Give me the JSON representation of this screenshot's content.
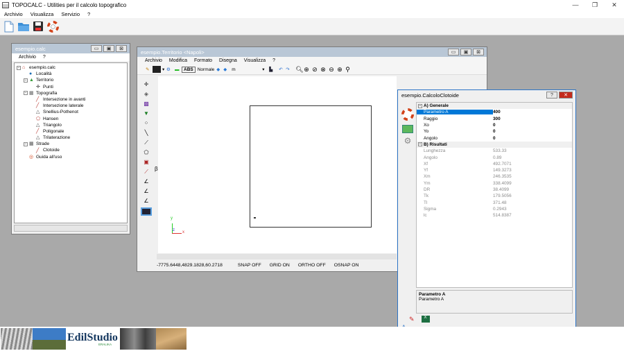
{
  "app": {
    "title": "TOPOCALC - Utilities per il calcolo topografico",
    "menu": [
      "Archivio",
      "Visualizza",
      "Servizio",
      "?"
    ]
  },
  "window_controls": {
    "min": "—",
    "max": "❐",
    "close": "✕"
  },
  "explorer": {
    "title": "esempio.calc",
    "menu": [
      "Archivio",
      "?"
    ],
    "tree": [
      {
        "label": "esempio.calc",
        "level": 0,
        "icon": "house-icon",
        "expand": "⊟"
      },
      {
        "label": "Località",
        "level": 1,
        "icon": "globe-icon"
      },
      {
        "label": "Territorio",
        "level": 1,
        "icon": "territory-icon",
        "expand": "⊟"
      },
      {
        "label": "Punti",
        "level": 2,
        "icon": "point-icon"
      },
      {
        "label": "Topografia",
        "level": 1,
        "icon": "topography-icon",
        "expand": "⊟"
      },
      {
        "label": "Intersezione in avanti",
        "level": 2,
        "icon": "line-icon"
      },
      {
        "label": "Intersezione laterale",
        "level": 2,
        "icon": "line-icon"
      },
      {
        "label": "Snellius-Pothenot",
        "level": 2,
        "icon": "triangle-icon"
      },
      {
        "label": "Hansen",
        "level": 2,
        "icon": "polygon-icon"
      },
      {
        "label": "Triangolo",
        "level": 2,
        "icon": "triangle-icon"
      },
      {
        "label": "Poligonale",
        "level": 2,
        "icon": "line-icon"
      },
      {
        "label": "Trilaterazione",
        "level": 2,
        "icon": "triangle-icon"
      },
      {
        "label": "Strade",
        "level": 1,
        "icon": "road-icon",
        "expand": "⊟"
      },
      {
        "label": "Clotoide",
        "level": 2,
        "icon": "line-icon"
      },
      {
        "label": "Guida all'uso",
        "level": 1,
        "icon": "lifebuoy-icon"
      }
    ]
  },
  "territorio": {
    "title": "esempio.Territorio <Napoli>",
    "menu": [
      "Archivio",
      "Modifica",
      "Formato",
      "Disegna",
      "Visualizza",
      "?"
    ],
    "toolbar": {
      "abs_label": "ABS",
      "style_value": "Normale",
      "unit_value": "m"
    },
    "status": {
      "coords": "-7775.6448,4829.1828,60.2718",
      "snap": "SNAP OFF",
      "grid": "GRID ON",
      "ortho": "ORTHO OFF",
      "osnap": "OSNAP ON"
    },
    "axis": {
      "y": "y",
      "z": "z",
      "x": "x"
    },
    "side_marker": "β"
  },
  "clotoide": {
    "title": "esempio.CalcoloClotoide",
    "help_btn": "?",
    "section_general": "A) Generale",
    "general": [
      {
        "k": "Parametro A",
        "v": "400",
        "selected": true
      },
      {
        "k": "Raggio",
        "v": "300"
      },
      {
        "k": "Xo",
        "v": "0"
      },
      {
        "k": "Yo",
        "v": "0"
      },
      {
        "k": "Angolo",
        "v": "0"
      }
    ],
    "section_results": "B) Risultati",
    "results": [
      {
        "k": "Lunghezza",
        "v": "533.33"
      },
      {
        "k": "Angolo",
        "v": "0.89"
      },
      {
        "k": "Xf",
        "v": "492.7071"
      },
      {
        "k": "Yf",
        "v": "149.3273"
      },
      {
        "k": "Xm",
        "v": "246.3535"
      },
      {
        "k": "Ym",
        "v": "338.4099"
      },
      {
        "k": "DR",
        "v": "38.4099"
      },
      {
        "k": "Tk",
        "v": "179.5056"
      },
      {
        "k": "Tl",
        "v": "371.48"
      },
      {
        "k": "Sigma",
        "v": "0.2943"
      },
      {
        "k": "lc",
        "v": "514.8387"
      }
    ],
    "desc_title": "Parametro A",
    "desc_text": "Parametro A",
    "footer_mark": "A"
  },
  "taskbar": {
    "brand": "EdilStudio",
    "brand_sub": "ERALIKA"
  },
  "colors": {
    "accent": "#0078d7",
    "active_caption": "#2b73c6",
    "inactive_caption": "#b9c7d6",
    "close_red": "#c42b1c"
  }
}
